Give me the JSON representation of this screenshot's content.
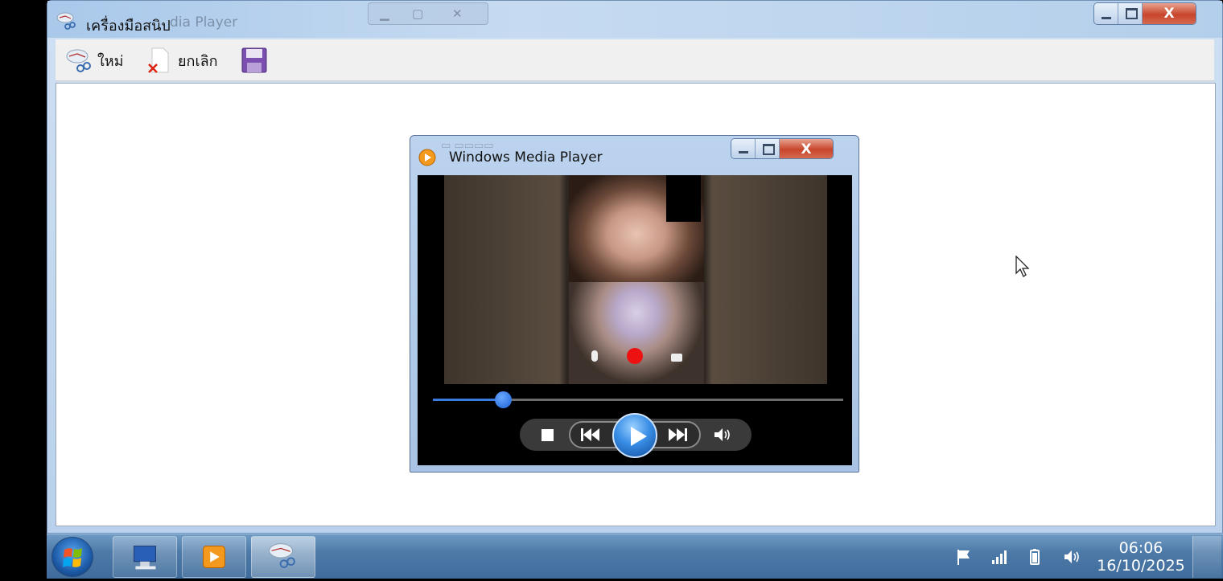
{
  "snipping_tool": {
    "title": "เครื่องมือสนิป",
    "ghost_title": "dia Player",
    "toolbar": {
      "new_label": "ใหม่",
      "cancel_label": "ยกเลิก",
      "save_icon": "floppy-disk-icon"
    },
    "caption": {
      "close": "X"
    }
  },
  "media_player": {
    "title": "Windows Media Player",
    "seek_progress": 0.17,
    "caption": {
      "close": "X"
    }
  },
  "taskbar": {
    "clock_time": "06:06",
    "clock_date": "16/10/2025",
    "pinned": [
      "computer-icon",
      "media-player-icon",
      "snipping-tool-icon"
    ],
    "tray": [
      "flag-icon",
      "signal-icon",
      "battery-icon",
      "volume-icon"
    ]
  },
  "colors": {
    "close_red": "#c8452b",
    "taskbar_blue": "#4d7aa8",
    "seek_blue": "#3a7be0"
  }
}
